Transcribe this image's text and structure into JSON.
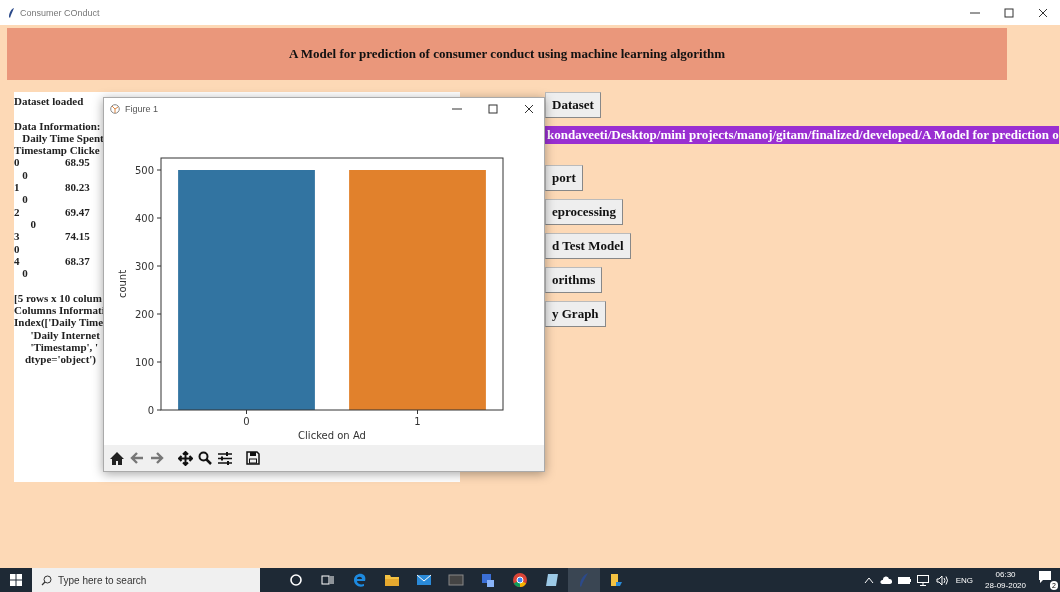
{
  "window": {
    "title": "Consumer COnduct"
  },
  "header": {
    "title": "A Model for prediction of consumer conduct using machine learning algorithm"
  },
  "console": {
    "blocks": [
      [
        {
          "kind": "text",
          "text": "Dataset loaded"
        }
      ],
      [
        {
          "kind": "text",
          "text": "Data Information:"
        },
        {
          "kind": "text",
          "text": "   Daily Time Spent"
        },
        {
          "kind": "text",
          "text": "Timestamp Clicke"
        },
        {
          "kind": "row",
          "index": "0",
          "value": "68.95"
        },
        {
          "kind": "text",
          "text": "   0"
        },
        {
          "kind": "row",
          "index": "1",
          "value": "80.23"
        },
        {
          "kind": "text",
          "text": "   0"
        },
        {
          "kind": "row",
          "index": "2",
          "value": "69.47"
        },
        {
          "kind": "text",
          "text": "      0"
        },
        {
          "kind": "row",
          "index": "3",
          "value": "74.15"
        },
        {
          "kind": "text",
          "text": "0"
        },
        {
          "kind": "row",
          "index": "4",
          "value": "68.37"
        },
        {
          "kind": "text",
          "text": "   0"
        }
      ],
      [
        {
          "kind": "text",
          "text": "[5 rows x 10 colum"
        },
        {
          "kind": "text",
          "text": "Columns Informati"
        },
        {
          "kind": "text",
          "text": "Index(['Daily Time"
        },
        {
          "kind": "text",
          "text": "      'Daily Internet"
        },
        {
          "kind": "text",
          "text": "      'Timestamp', '"
        },
        {
          "kind": "text",
          "text": "    dtype='object')"
        }
      ]
    ]
  },
  "actions": [
    {
      "kind": "button",
      "label": "Dataset"
    },
    {
      "kind": "path",
      "label": "kondaveeti/Desktop/mini projects/manoj/gitam/finalized/developed/A Model for prediction o"
    },
    {
      "kind": "button",
      "label": "port"
    },
    {
      "kind": "button",
      "label": "eprocessing"
    },
    {
      "kind": "button",
      "label": "d Test Model"
    },
    {
      "kind": "button",
      "label": "orithms"
    },
    {
      "kind": "button",
      "label": "y Graph"
    }
  ],
  "figure": {
    "title": "Figure 1",
    "chart_data": {
      "type": "bar",
      "xlabel": "Clicked on Ad",
      "ylabel": "count",
      "categories": [
        "0",
        "1"
      ],
      "series": [
        {
          "color": "#3274a1",
          "values": [
            500,
            null
          ]
        },
        {
          "color": "#e1812c",
          "values": [
            null,
            500
          ]
        }
      ],
      "ylim": [
        0,
        525
      ],
      "yticks": [
        0,
        100,
        200,
        300,
        400,
        500
      ]
    }
  },
  "taskbar": {
    "search": {
      "placeholder": "Type here to search"
    },
    "language": "ENG",
    "time": "06:30",
    "date": "28-09-2020",
    "notifications": "2"
  }
}
